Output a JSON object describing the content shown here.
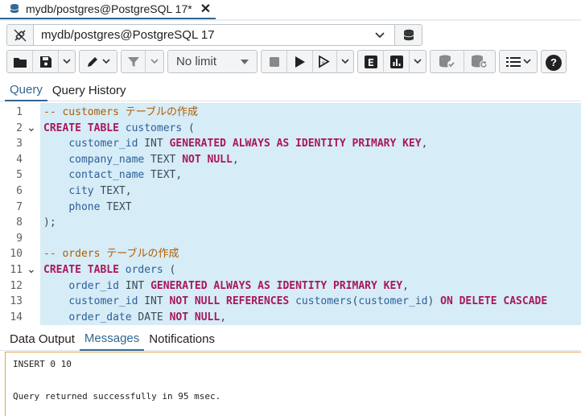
{
  "window": {
    "tab_title": "mydb/postgres@PostgreSQL 17*",
    "close_glyph": "✕"
  },
  "connection": {
    "value": "mydb/postgres@PostgreSQL 17"
  },
  "toolbar": {
    "limit_value": "No limit",
    "help_label": "?"
  },
  "query_tabs": [
    {
      "label": "Query",
      "active": true
    },
    {
      "label": "Query History",
      "active": false
    }
  ],
  "editor": {
    "lines": [
      {
        "n": "1",
        "fold": false,
        "tokens": [
          [
            "cm",
            "-- customers テーブルの作成"
          ]
        ]
      },
      {
        "n": "2",
        "fold": true,
        "tokens": [
          [
            "kw",
            "CREATE TABLE"
          ],
          [
            "pl",
            " "
          ],
          [
            "id",
            "customers"
          ],
          [
            "pl",
            " ("
          ]
        ]
      },
      {
        "n": "3",
        "fold": false,
        "tokens": [
          [
            "pl",
            "    "
          ],
          [
            "id",
            "customer_id"
          ],
          [
            "pl",
            " INT "
          ],
          [
            "kw",
            "GENERATED ALWAYS AS IDENTITY PRIMARY KEY"
          ],
          [
            "pl",
            ","
          ]
        ]
      },
      {
        "n": "4",
        "fold": false,
        "tokens": [
          [
            "pl",
            "    "
          ],
          [
            "id",
            "company_name"
          ],
          [
            "pl",
            " TEXT "
          ],
          [
            "kw",
            "NOT NULL"
          ],
          [
            "pl",
            ","
          ]
        ]
      },
      {
        "n": "5",
        "fold": false,
        "tokens": [
          [
            "pl",
            "    "
          ],
          [
            "id",
            "contact_name"
          ],
          [
            "pl",
            " TEXT,"
          ]
        ]
      },
      {
        "n": "6",
        "fold": false,
        "tokens": [
          [
            "pl",
            "    "
          ],
          [
            "id",
            "city"
          ],
          [
            "pl",
            " TEXT,"
          ]
        ]
      },
      {
        "n": "7",
        "fold": false,
        "tokens": [
          [
            "pl",
            "    "
          ],
          [
            "id",
            "phone"
          ],
          [
            "pl",
            " TEXT"
          ]
        ]
      },
      {
        "n": "8",
        "fold": false,
        "tokens": [
          [
            "pl",
            ");"
          ]
        ]
      },
      {
        "n": "9",
        "fold": false,
        "tokens": []
      },
      {
        "n": "10",
        "fold": false,
        "tokens": [
          [
            "cm",
            "-- orders テーブルの作成"
          ]
        ]
      },
      {
        "n": "11",
        "fold": true,
        "tokens": [
          [
            "kw",
            "CREATE TABLE"
          ],
          [
            "pl",
            " "
          ],
          [
            "id",
            "orders"
          ],
          [
            "pl",
            " ("
          ]
        ]
      },
      {
        "n": "12",
        "fold": false,
        "tokens": [
          [
            "pl",
            "    "
          ],
          [
            "id",
            "order_id"
          ],
          [
            "pl",
            " INT "
          ],
          [
            "kw",
            "GENERATED ALWAYS AS IDENTITY PRIMARY KEY"
          ],
          [
            "pl",
            ","
          ]
        ]
      },
      {
        "n": "13",
        "fold": false,
        "tokens": [
          [
            "pl",
            "    "
          ],
          [
            "id",
            "customer_id"
          ],
          [
            "pl",
            " INT "
          ],
          [
            "kw",
            "NOT NULL REFERENCES"
          ],
          [
            "pl",
            " "
          ],
          [
            "id",
            "customers"
          ],
          [
            "pl",
            "("
          ],
          [
            "id",
            "customer_id"
          ],
          [
            "pl",
            ") "
          ],
          [
            "kw",
            "ON DELETE CASCADE"
          ]
        ]
      },
      {
        "n": "14",
        "fold": false,
        "tokens": [
          [
            "pl",
            "    "
          ],
          [
            "id",
            "order_date"
          ],
          [
            "pl",
            " DATE "
          ],
          [
            "kw",
            "NOT NULL"
          ],
          [
            "pl",
            ","
          ]
        ]
      }
    ]
  },
  "result_tabs": [
    {
      "label": "Data Output",
      "active": false
    },
    {
      "label": "Messages",
      "active": true
    },
    {
      "label": "Notifications",
      "active": false
    }
  ],
  "messages": {
    "line1": "INSERT 0 10",
    "line2": "",
    "line3": "Query returned successfully in 95 msec."
  },
  "colors": {
    "accent": "#326690",
    "editor_bg": "#d6ecf7",
    "keyword": "#a9175d",
    "comment": "#b05c00",
    "identifier": "#2d5f9a",
    "message_border": "#e0a64a"
  }
}
